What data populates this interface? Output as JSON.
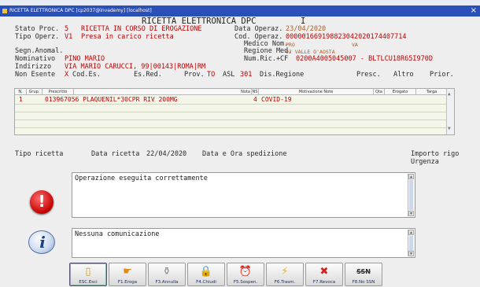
{
  "window": {
    "title": "RICETTA ELETTRONICA DPC [cp2037@invademy] [localhost]"
  },
  "header": {
    "main_title": "RICETTA ELETTRONICA DPC",
    "cursor_mark": "I",
    "stato_proc_label": "Stato Proc.",
    "stato_proc_code": "5",
    "stato_proc_desc": "RICETTA IN CORSO DI EROGAZIONE",
    "tipo_operz_label": "Tipo Operz.",
    "tipo_operz_code": "V1",
    "tipo_operz_desc": "Presa in carico ricetta",
    "data_operaz_label": "Data Operaz.",
    "data_operaz": "23/04/2020",
    "cod_operaz_label": "Cod. Operaz.",
    "cod_operaz": "000001669198823042020174407714",
    "medico_label": "Medico Nom.",
    "medico_value": "PRO",
    "medico_extra": "VA",
    "segn_anomal_label": "Segn.Anomal.",
    "regione_label": "Regione Med.",
    "regione_value": "02 VALLE D'AOSTA",
    "nominativo_label": "Nominativo",
    "nominativo": "PINO MARIO",
    "num_ric_label": "Num.Ric.+CF",
    "num_ric": "0200A4005045007 - BLTLCU18R65I970D",
    "indirizzo_label": "Indirizzo",
    "indirizzo": "VIA MARIO CARUCCI, 99|00143|ROMA|RM",
    "non_esente_label": "Non Esente",
    "non_esente_flag": "X",
    "cod_es_label": "Cod.Es.",
    "es_red_label": "Es.Red.",
    "prov_label": "Prov.",
    "prov_value": "TO",
    "asl_label": "ASL",
    "asl_value": "301",
    "dis_regione_label": "Dis.Regione",
    "presc_label": "Presc.",
    "altro_label": "Altro",
    "prior_label": "Prior."
  },
  "grid": {
    "columns": [
      "N.",
      "Grup.",
      "Prescritto",
      "Nota",
      "NS",
      "Motivazione Note",
      "Qta",
      "Erogato",
      "Targa"
    ],
    "rows": [
      {
        "n": "1",
        "grup": "",
        "prescritto": "013967056 PLAQUENIL*30CPR RIV 200MG",
        "nota": "",
        "ns": "4",
        "motivazione": "COVID-19",
        "qta": "",
        "erogato": "",
        "targa": ""
      }
    ],
    "scroll_up": "▲",
    "scroll_down": "▼"
  },
  "summary": {
    "tipo_ricetta_label": "Tipo ricetta",
    "data_ricetta_label": "Data ricetta",
    "data_ricetta": "22/04/2020",
    "data_ora_label": "Data e Ora spedizione",
    "importo_label": "Importo rigo",
    "urgenza_label": "Urgenza"
  },
  "messages": {
    "error_text": "Operazione eseguita correttamente",
    "info_text": "Nessuna comunicazione",
    "error_icon_glyph": "!",
    "info_icon_glyph": "i"
  },
  "toolbar": {
    "buttons": [
      {
        "label": "ESC.Esci",
        "icon": "exit-door-icon",
        "glyph": "▯",
        "color": "#c9a227"
      },
      {
        "label": "F1.Eroga",
        "icon": "hand-pointer-icon",
        "glyph": "☛",
        "color": "#e08a1e"
      },
      {
        "label": "F3.Annulla",
        "icon": "jar-icon",
        "glyph": "⚱",
        "color": "#8a8a8a"
      },
      {
        "label": "F4.Chiudi",
        "icon": "padlock-icon",
        "glyph": "🔒",
        "color": "#d4a017"
      },
      {
        "label": "F5.Sospen.",
        "icon": "alarm-clock-icon",
        "glyph": "⏰",
        "color": "#e07020"
      },
      {
        "label": "F6.Trasm.",
        "icon": "lightning-icon",
        "glyph": "⚡",
        "color": "#f0b020"
      },
      {
        "label": "F7.Revoca",
        "icon": "red-x-icon",
        "glyph": "✖",
        "color": "#d02020"
      },
      {
        "label": "F8.No SSN",
        "icon": "no-ssn-icon",
        "glyph": "SSN",
        "color": "#222222"
      }
    ]
  }
}
